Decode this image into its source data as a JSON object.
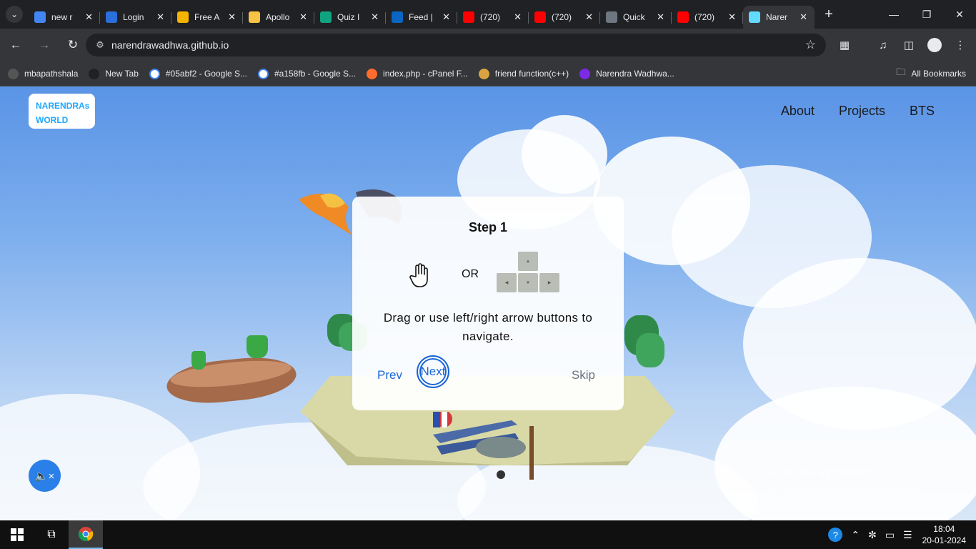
{
  "browser": {
    "tabs": [
      {
        "title": "new r",
        "icon": "docs-icon",
        "color": "#4285f4"
      },
      {
        "title": "Login",
        "icon": "s-icon",
        "color": "#2a6fdb"
      },
      {
        "title": "Free A",
        "icon": "bars-icon",
        "color": "#f4b400"
      },
      {
        "title": "Apollo",
        "icon": "apollo-icon",
        "color": "#f6c344"
      },
      {
        "title": "Quiz I",
        "icon": "openai-icon",
        "color": "#10a37f"
      },
      {
        "title": "Feed |",
        "icon": "linkedin-icon",
        "color": "#0a66c2"
      },
      {
        "title": "(720)",
        "icon": "youtube-icon",
        "color": "#ff0000"
      },
      {
        "title": "(720)",
        "icon": "youtube-icon",
        "color": "#ff0000"
      },
      {
        "title": "Quick",
        "icon": "github-icon",
        "color": "#6e7681"
      },
      {
        "title": "(720)",
        "icon": "youtube-icon",
        "color": "#ff0000"
      },
      {
        "title": "Narer",
        "icon": "react-icon",
        "color": "#61dafb"
      }
    ],
    "url": "narendrawadhwa.github.io",
    "bookmarks": [
      {
        "label": "mbapathshala",
        "icon": "mbapathshala-icon",
        "color": "#555555"
      },
      {
        "label": "New Tab",
        "icon": "globe-icon",
        "color": "#202124"
      },
      {
        "label": "#05abf2 - Google S...",
        "icon": "google-icon",
        "color": "#ffffff"
      },
      {
        "label": "#a158fb - Google S...",
        "icon": "google-icon",
        "color": "#ffffff"
      },
      {
        "label": "index.php - cPanel F...",
        "icon": "cpanel-icon",
        "color": "#ff6c2c"
      },
      {
        "label": "friend function(c++)",
        "icon": "gfg-icon",
        "color": "#d9a441"
      },
      {
        "label": "Narendra Wadhwa...",
        "icon": "canva-icon",
        "color": "#7d2ae8"
      }
    ],
    "all_bookmarks": "All Bookmarks"
  },
  "site": {
    "logo_line1": "NARENDRAs",
    "logo_line2": "WORLD",
    "nav": [
      "About",
      "Projects",
      "BTS"
    ]
  },
  "tutorial": {
    "title": "Step 1",
    "or": "OR",
    "description": "Drag or use left/right arrow buttons to navigate.",
    "prev": "Prev",
    "next": "Next",
    "skip": "Skip"
  },
  "watermark": {
    "line1": "Activate Windows",
    "line2": "Go to Settings to activate Windows."
  },
  "taskbar": {
    "time": "18:04",
    "date": "20-01-2024"
  }
}
